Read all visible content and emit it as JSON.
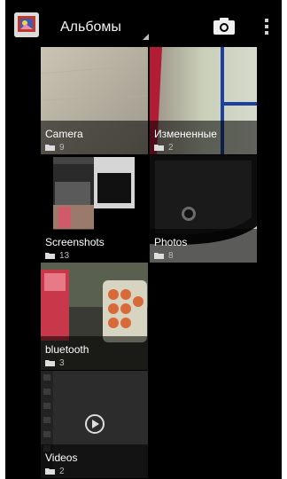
{
  "action_bar": {
    "title": "Альбомы",
    "app_icon": "gallery-app-icon",
    "camera_icon": "camera-icon",
    "overflow_icon": "overflow-menu-icon"
  },
  "albums": [
    {
      "name": "Camera",
      "count": "9"
    },
    {
      "name": "Измененные",
      "count": "2"
    },
    {
      "name": "Screenshots",
      "count": "13"
    },
    {
      "name": "Photos",
      "count": "8"
    },
    {
      "name": "bluetooth",
      "count": "3"
    },
    {
      "name": "Videos",
      "count": "2"
    }
  ],
  "colors": {
    "background": "#000000",
    "caption_overlay": "#000000",
    "caption_text": "#ffffff"
  }
}
